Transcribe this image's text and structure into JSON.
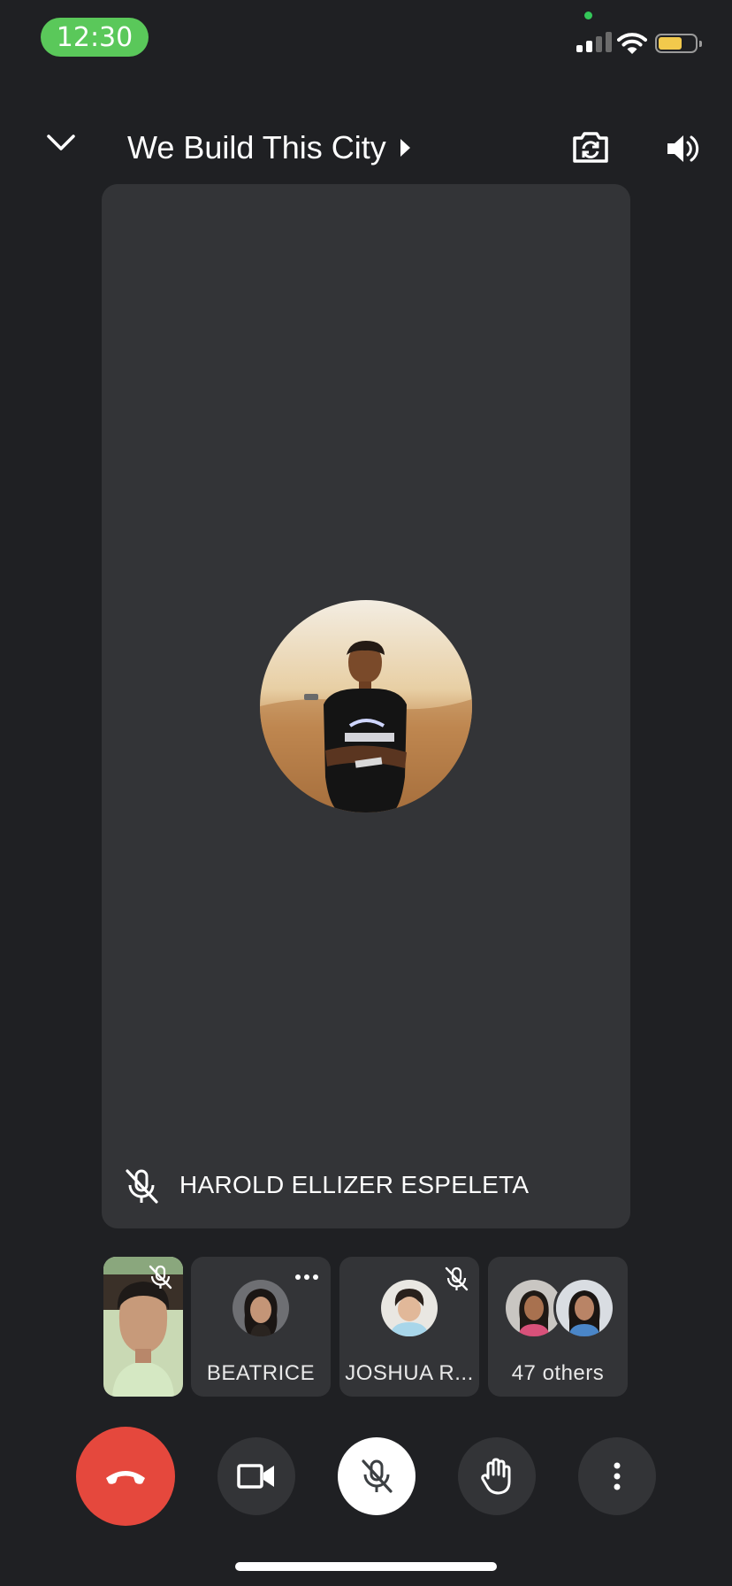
{
  "status_bar": {
    "time": "12:30"
  },
  "header": {
    "meeting_title": "We Build This City"
  },
  "main_tile": {
    "participant_name": "HAROLD ELLIZER ESPELETA",
    "muted": true
  },
  "participants": [
    {
      "id": "self",
      "label": "",
      "muted": true
    },
    {
      "id": "beatrice",
      "label": "BEATRICE",
      "muted": false
    },
    {
      "id": "joshua",
      "label": "JOSHUA R...",
      "muted": true
    },
    {
      "id": "others",
      "label": "47 others"
    }
  ],
  "controls": [
    "end-call",
    "camera",
    "microphone-muted",
    "raise-hand",
    "more-options"
  ],
  "colors": {
    "background": "#1f2023",
    "tile": "#333437",
    "end_call": "#e5483d",
    "time_pill": "#5ac85a",
    "battery": "#f2c94c"
  }
}
